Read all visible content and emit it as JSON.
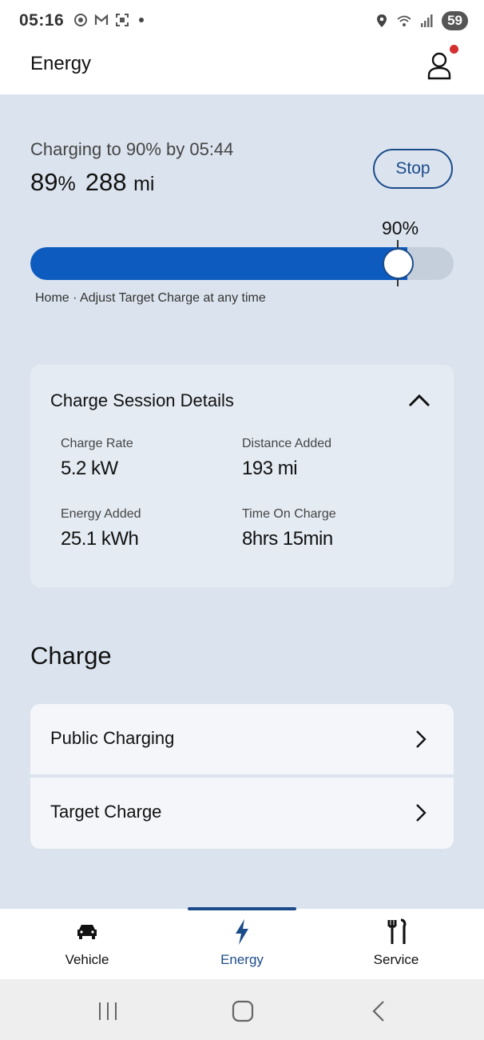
{
  "status_bar": {
    "time": "05:16",
    "battery_level": "59"
  },
  "header": {
    "title": "Energy"
  },
  "charging": {
    "title": "Charging to 90% by 05:44",
    "battery_percent": "89",
    "percent_unit": "%",
    "range": "288",
    "range_unit": "mi",
    "stop_label": "Stop",
    "target_label": "90%",
    "current_level": 0.89,
    "target_level": 0.9,
    "caption": "Home · Adjust Target Charge at any time"
  },
  "session_details": {
    "title": "Charge Session Details",
    "items": [
      {
        "label": "Charge Rate",
        "value": "5.2 kW"
      },
      {
        "label": "Distance Added",
        "value": "193 mi"
      },
      {
        "label": "Energy Added",
        "value": "25.1 kWh"
      },
      {
        "label": "Time On Charge",
        "value": "8hrs 15min"
      }
    ]
  },
  "charge_section": {
    "heading": "Charge",
    "items": [
      {
        "label": "Public Charging"
      },
      {
        "label": "Target Charge"
      }
    ]
  },
  "bottom_nav": {
    "items": [
      {
        "label": "Vehicle",
        "icon": "car-icon"
      },
      {
        "label": "Energy",
        "icon": "lightning-icon"
      },
      {
        "label": "Service",
        "icon": "tools-icon"
      }
    ],
    "active": "Energy"
  },
  "colors": {
    "accent": "#1c4b8a",
    "fill": "#0d5bbf",
    "background": "#dbe4ee",
    "notification": "#d32f2f"
  }
}
